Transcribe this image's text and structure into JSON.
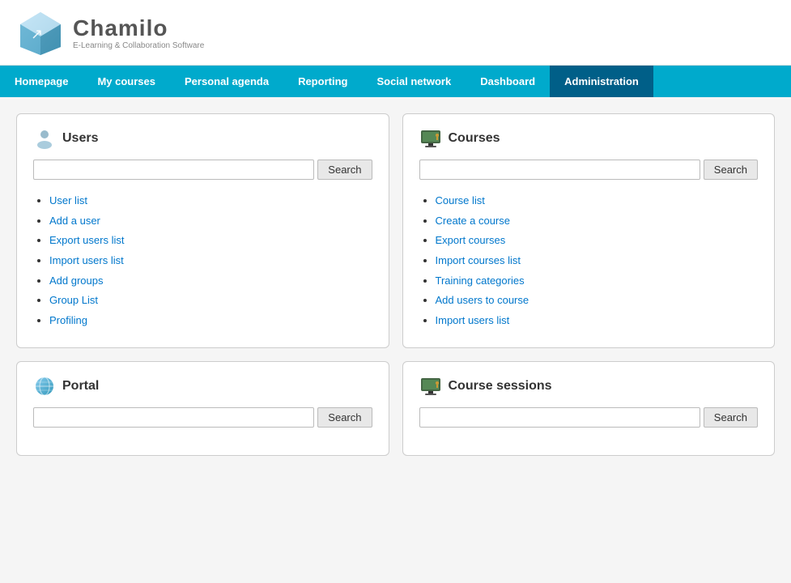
{
  "header": {
    "logo_title": "Chamilo",
    "logo_subtitle": "E-Learning & Collaboration Software"
  },
  "nav": {
    "items": [
      {
        "label": "Homepage",
        "active": false
      },
      {
        "label": "My courses",
        "active": false
      },
      {
        "label": "Personal agenda",
        "active": false
      },
      {
        "label": "Reporting",
        "active": false
      },
      {
        "label": "Social network",
        "active": false
      },
      {
        "label": "Dashboard",
        "active": false
      },
      {
        "label": "Administration",
        "active": true
      }
    ]
  },
  "cards": {
    "users": {
      "title": "Users",
      "search_placeholder": "",
      "search_btn": "Search",
      "links": [
        "User list",
        "Add a user",
        "Export users list",
        "Import users list",
        "Add groups",
        "Group List",
        "Profiling"
      ]
    },
    "courses": {
      "title": "Courses",
      "search_placeholder": "",
      "search_btn": "Search",
      "links": [
        "Course list",
        "Create a course",
        "Export courses",
        "Import courses list",
        "Training categories",
        "Add users to course",
        "Import users list"
      ]
    },
    "portal": {
      "title": "Portal",
      "search_placeholder": "",
      "search_btn": "Search",
      "links": []
    },
    "course_sessions": {
      "title": "Course sessions",
      "search_placeholder": "",
      "search_btn": "Search",
      "links": []
    }
  }
}
